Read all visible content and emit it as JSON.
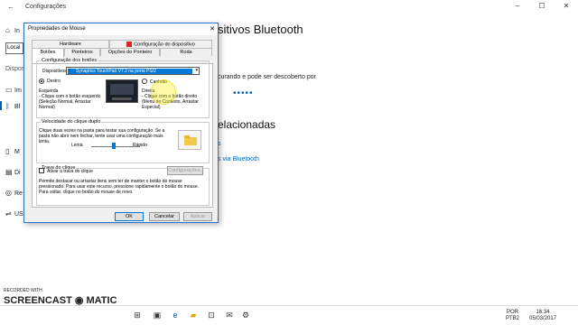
{
  "settings": {
    "title": "Configurações",
    "back_icon": "back-arrow-icon",
    "search_value": "Local",
    "section_header": "Dispos",
    "nav": [
      {
        "icon": "home-icon",
        "label": "In"
      },
      {
        "icon": "search-icon",
        "label": "In"
      },
      {
        "icon": "printer-icon",
        "label": "Im"
      },
      {
        "icon": "bluetooth-icon",
        "label": "Bl"
      },
      {
        "icon": "mouse-icon",
        "label": "M"
      },
      {
        "icon": "keyboard-icon",
        "label": "Di"
      },
      {
        "icon": "autoplay-icon",
        "label": "Re"
      },
      {
        "icon": "usb-icon",
        "label": "US"
      }
    ],
    "main_title": "sitivos Bluetooth",
    "main_text": "curando e pode ser descoberto por",
    "searching_dots": "•••••",
    "related_title": "elacionadas",
    "related_link1": "s",
    "related_link2": "s via Bluetooth"
  },
  "dialog": {
    "title": "Propriedades de Mouse",
    "close": "✕",
    "tabs_row1": [
      "Hardware",
      "Configuração do dispositivo"
    ],
    "tabs_row2": [
      "Botões",
      "Ponteiros",
      "Opções do Ponteiro",
      "Roda"
    ],
    "buttons_group": {
      "label": "Configuração dos botões",
      "device_label": "Dispositivos",
      "device_value": "Synaptics TouchPad V7.2 na porta PS/2",
      "radio_right": "Destro",
      "radio_left": "Canhoto",
      "left_head": "Esquerda",
      "left_desc": "- Clique com o botão esquerdo (Seleção Normal, Arrastar Normal)",
      "right_head": "Direita",
      "right_desc": "- Clique com o botão direito (Menu de Contexto, Arrastar Especial)"
    },
    "dblclick_group": {
      "label": "Velocidade do clique duplo",
      "desc": "Clique duas vezes na pasta para testar sua configuração. Se a pasta não abrir nem fechar, tente usar uma configuração mais lenta.",
      "slow": "Lenta",
      "fast": "Rápido"
    },
    "clicklock_group": {
      "label": "Trava do clique",
      "checkbox": "Ativar a trava do clique",
      "settings_button": "Configurações...",
      "desc": "Permite destacar ou arrastar itens sem ter de manter o botão do mouse pressionado. Para usar este recurso, pressione rapidamente o botão do mouse. Para soltar, clique no botão do mouse de novo."
    },
    "ok": "OK",
    "cancel": "Cancelar",
    "apply": "Aplicar"
  },
  "taskbar": {
    "watermark_top": "RECORDED WITH",
    "watermark": "SCREENCAST ◉ MATIC",
    "icons": [
      "windows-icon",
      "task-view-icon",
      "edge-icon",
      "file-explorer-icon",
      "store-icon",
      "mail-icon",
      "settings-icon"
    ],
    "lang1": "POR",
    "lang2": "PTB2",
    "time": "16:34",
    "date": "05/03/2017"
  }
}
